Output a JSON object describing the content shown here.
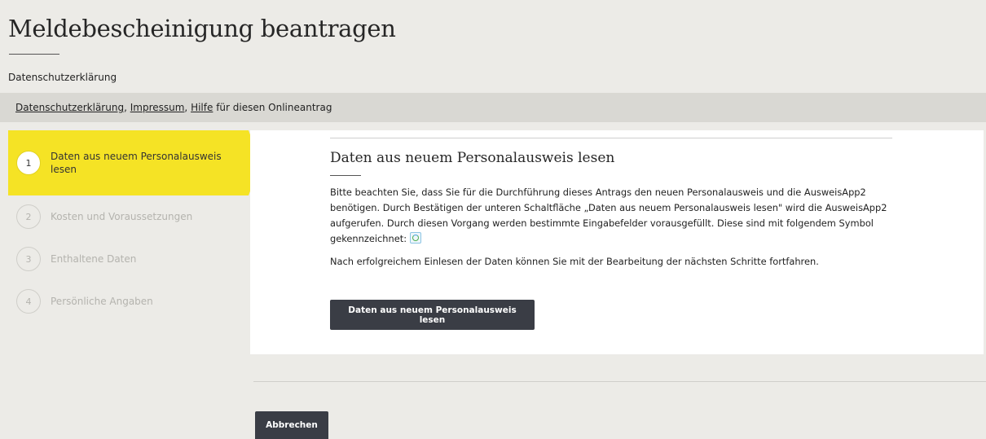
{
  "page": {
    "title": "Meldebescheinigung beantragen",
    "section_label": "Datenschutzerklärung"
  },
  "links_bar": {
    "link_privacy": "Datenschutzerklärung",
    "sep1": ", ",
    "link_imprint": "Impressum",
    "sep2": ", ",
    "link_help": "Hilfe",
    "suffix": " für diesen Onlineantrag"
  },
  "steps": [
    {
      "number": "1",
      "label": "Daten aus neuem Personalausweis lesen",
      "active": true
    },
    {
      "number": "2",
      "label": "Kosten und Voraussetzungen",
      "active": false
    },
    {
      "number": "3",
      "label": "Enthaltene Daten",
      "active": false
    },
    {
      "number": "4",
      "label": "Persönliche Angaben",
      "active": false
    }
  ],
  "main": {
    "heading": "Daten aus neuem Personalausweis lesen",
    "paragraph1": "Bitte beachten Sie, dass Sie für die Durchführung dieses Antrags den neuen Personalausweis und die AusweisApp2 benötigen. Durch Bestätigen der unteren Schaltfläche „Daten aus neuem Personalausweis lesen\" wird die AusweisApp2 aufgerufen. Durch diesen Vorgang werden bestimmte Eingabefelder vorausgefüllt. Diese sind mit folgendem Symbol gekennzeichnet: ",
    "symbol_icon": "eid-prefill-icon",
    "paragraph2": "Nach erfolgreichem Einlesen der Daten können Sie mit der Bearbeitung der nächsten Schritte fortfahren.",
    "button_label": "Daten aus neuem Personalausweis lesen"
  },
  "footer": {
    "cancel_label": "Abbrechen"
  },
  "colors": {
    "active_step": "#f5e325",
    "button": "#3a3d45",
    "background": "#ecebe7"
  }
}
